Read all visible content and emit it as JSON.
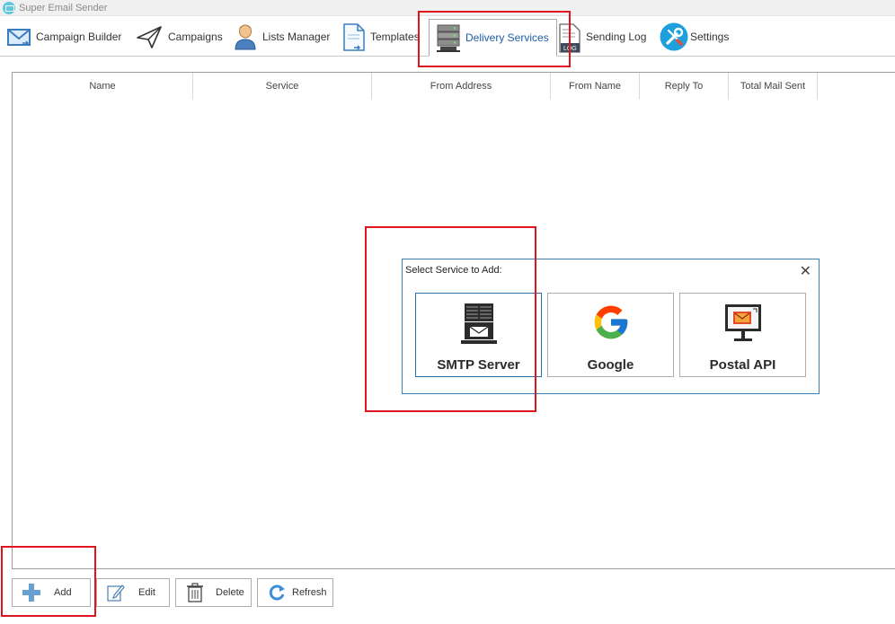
{
  "window": {
    "title": "Super Email Sender"
  },
  "tabs": [
    {
      "label": "Campaign Builder",
      "icon": "envelope-arrows-icon"
    },
    {
      "label": "Campaigns",
      "icon": "paper-plane-icon"
    },
    {
      "label": "Lists Manager",
      "icon": "user-icon"
    },
    {
      "label": "Templates",
      "icon": "document-icon"
    },
    {
      "label": "Delivery Services",
      "icon": "server-icon",
      "active": true
    },
    {
      "label": "Sending Log",
      "icon": "log-icon"
    },
    {
      "label": "Settings",
      "icon": "wrench-screwdriver-icon"
    }
  ],
  "table": {
    "columns": [
      "Name",
      "Service",
      "From Address",
      "From Name",
      "Reply To",
      "Total Mail Sent"
    ],
    "rows": []
  },
  "dialog": {
    "title": "Select Service to Add:",
    "close_glyph": "✕",
    "services": [
      {
        "label": "SMTP Server",
        "icon": "smtp-server-icon",
        "selected": true
      },
      {
        "label": "Google",
        "icon": "google-icon"
      },
      {
        "label": "Postal API",
        "icon": "postal-api-icon"
      }
    ]
  },
  "actions": {
    "add": "Add",
    "edit": "Edit",
    "delete": "Delete",
    "refresh": "Refresh"
  },
  "colors": {
    "highlight": "#e0141c",
    "active_tab_text": "#1f5ea8",
    "dialog_border": "#3c7fb3"
  }
}
